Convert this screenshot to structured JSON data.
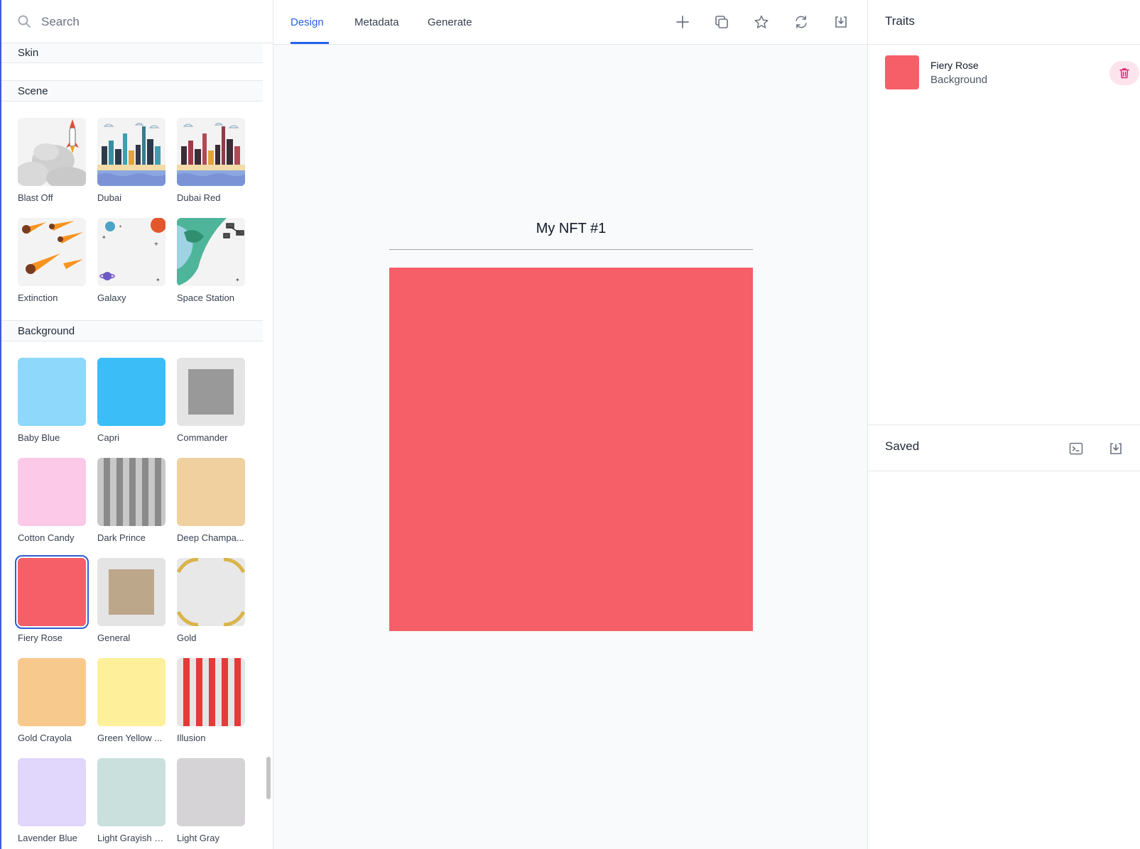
{
  "search": {
    "placeholder": "Search"
  },
  "sections": {
    "skin": {
      "title": "Skin"
    },
    "scene": {
      "title": "Scene",
      "items": [
        "Blast Off",
        "Dubai",
        "Dubai Red",
        "Extinction",
        "Galaxy",
        "Space Station"
      ]
    },
    "background": {
      "title": "Background",
      "items": [
        {
          "label": "Baby Blue",
          "color": "#8dd8fb"
        },
        {
          "label": "Capri",
          "color": "#3bbdf8"
        },
        {
          "label": "Commander",
          "color": "#e4e4e4",
          "inner": "#999999"
        },
        {
          "label": "Cotton Candy",
          "color": "#fcc9e8"
        },
        {
          "label": "Dark Prince",
          "color": "#c8c8c8",
          "stripes": "#8a8a8a"
        },
        {
          "label": "Deep Champa...",
          "color": "#efd09e"
        },
        {
          "label": "Fiery Rose",
          "color": "#f65f68",
          "selected": true
        },
        {
          "label": "General",
          "color": "#e4e4e4",
          "inner": "#bda78a"
        },
        {
          "label": "Gold",
          "color": "#e8e8e8",
          "ornament": "#d9b44a"
        },
        {
          "label": "Gold Crayola",
          "color": "#f8c98d"
        },
        {
          "label": "Green Yellow ...",
          "color": "#fef09b"
        },
        {
          "label": "Illusion",
          "color": "#e5e5e5",
          "stripes": "#e43a3a"
        },
        {
          "label": "Lavender Blue",
          "color": "#e1d6fb"
        },
        {
          "label": "Light Grayish Cyan",
          "color": "#c9e0dd"
        },
        {
          "label": "Light Gray",
          "color": "#d5d3d6"
        }
      ]
    }
  },
  "tabs": [
    {
      "label": "Design",
      "active": true
    },
    {
      "label": "Metadata"
    },
    {
      "label": "Generate"
    }
  ],
  "toolbar": [
    "plus-icon",
    "duplicate-icon",
    "star-icon",
    "refresh-icon",
    "download-icon"
  ],
  "canvas": {
    "title": "My NFT #1",
    "color": "#f65f68"
  },
  "traits": {
    "title": "Traits",
    "items": [
      {
        "name": "Fiery Rose",
        "category": "Background",
        "color": "#f65f68"
      }
    ]
  },
  "saved": {
    "title": "Saved"
  },
  "colors": {
    "accent": "#2563eb",
    "delete_bg": "#fde4ec",
    "delete_icon": "#db2777"
  }
}
